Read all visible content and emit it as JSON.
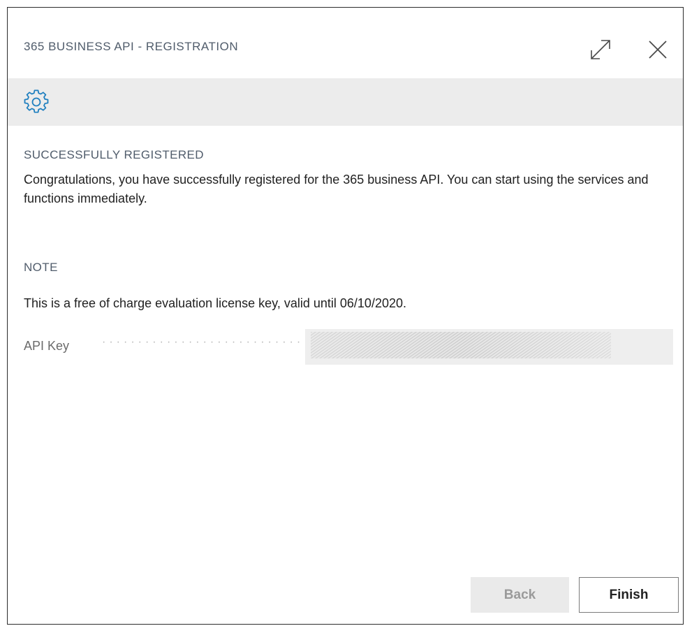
{
  "dialog": {
    "title": "365 BUSINESS API - REGISTRATION"
  },
  "icons": {
    "expand": "expand-icon",
    "close": "close-icon",
    "settings": "gear-icon"
  },
  "colors": {
    "accent": "#1f7fbf",
    "toolbar_bg": "#ececec",
    "title_text": "#505c6b"
  },
  "success": {
    "title": "SUCCESSFULLY REGISTERED",
    "message": "Congratulations, you have successfully registered for the 365 business API. You can start using the services and functions immediately."
  },
  "note": {
    "title": "NOTE",
    "message": "This is a free of charge evaluation license key, valid until 06/10/2020."
  },
  "api_key": {
    "label": "API Key",
    "value": ""
  },
  "footer": {
    "back_label": "Back",
    "finish_label": "Finish"
  }
}
